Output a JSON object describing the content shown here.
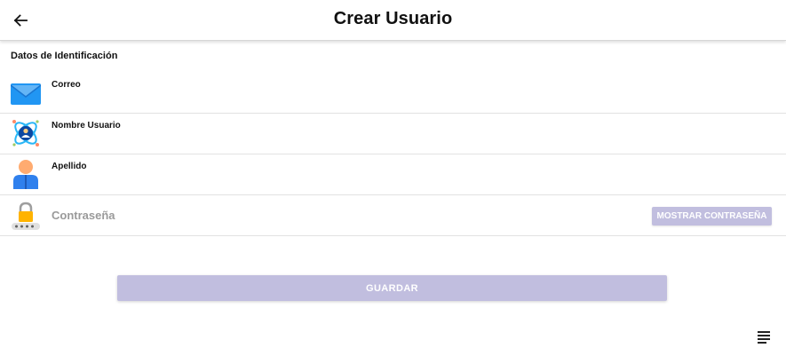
{
  "header": {
    "title": "Crear Usuario",
    "back_icon": "arrow-left-icon"
  },
  "form": {
    "section_title": "Datos de Identificación",
    "fields": [
      {
        "label": "Correo",
        "icon": "envelope-icon"
      },
      {
        "label": "Nombre Usuario",
        "icon": "user-atom-icon"
      },
      {
        "label": "Apellido",
        "icon": "person-icon"
      }
    ],
    "password": {
      "placeholder": "Contraseña",
      "icon": "padlock-icon",
      "show_button_label": "MOSTRAR CONTRASEÑA"
    },
    "save_button_label": "GUARDAR"
  },
  "footer": {
    "menu_icon": "text-lines-icon"
  },
  "colors": {
    "button_disabled": "#c1bedf",
    "text": "#111111",
    "divider": "#e2e2e2"
  }
}
